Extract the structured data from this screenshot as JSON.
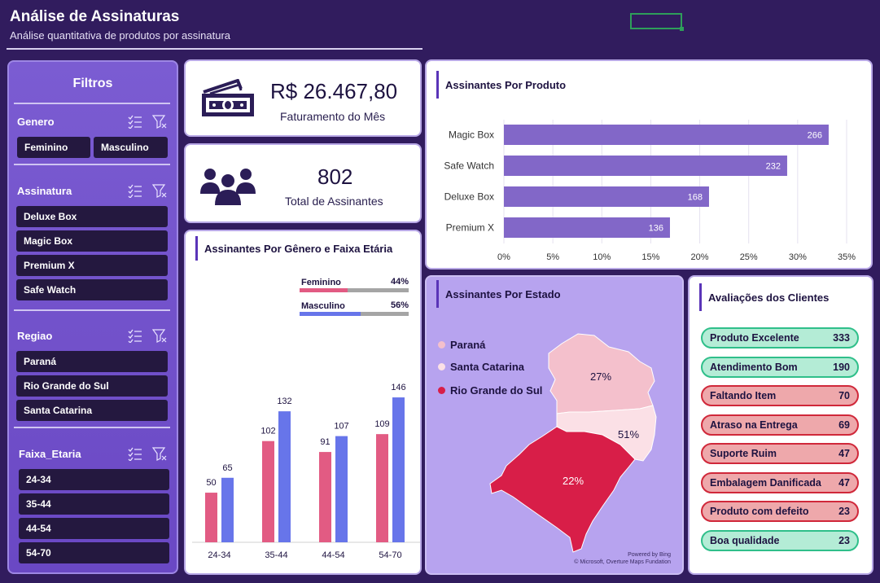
{
  "header": {
    "title": "Análise de Assinaturas",
    "subtitle": "Análise quantitativa de produtos por assinatura"
  },
  "filters": {
    "title": "Filtros",
    "genero": {
      "label": "Genero",
      "options": [
        "Feminino",
        "Masculino"
      ]
    },
    "assinatura": {
      "label": "Assinatura",
      "options": [
        "Deluxe Box",
        "Magic Box",
        "Premium X",
        "Safe Watch"
      ]
    },
    "regiao": {
      "label": "Regiao",
      "options": [
        "Paraná",
        "Rio Grande do Sul",
        "Santa Catarina"
      ]
    },
    "faixa": {
      "label": "Faixa_Etaria",
      "options": [
        "24-34",
        "35-44",
        "44-54",
        "54-70"
      ]
    }
  },
  "kpis": {
    "revenue_value": "R$ 26.467,80",
    "revenue_label": "Faturamento do Mês",
    "subs_value": "802",
    "subs_label": "Total de Assinantes"
  },
  "colors": {
    "background": "#311c5e",
    "bar_purple": "#8267c8",
    "female": "#e25b83",
    "male": "#6775ea",
    "parana": "#f4c0cc",
    "santa_catarina": "#fbe0e6",
    "rio_grande": "#d81e48",
    "good": "#b4ecd6",
    "bad": "#eea8ab"
  },
  "product_chart": {
    "title": "Assinantes Por Produto",
    "chart_data": {
      "type": "bar",
      "orientation": "horizontal",
      "categories": [
        "Magic Box",
        "Safe Watch",
        "Deluxe Box",
        "Premium X"
      ],
      "values": [
        266,
        232,
        168,
        136
      ],
      "total": 802,
      "xlim_percent": [
        0,
        35
      ],
      "xticks": [
        "0%",
        "5%",
        "10%",
        "15%",
        "20%",
        "25%",
        "30%",
        "35%"
      ]
    }
  },
  "gender_chart": {
    "title": "Assinantes Por Gênero e Faixa Etária",
    "legend": [
      {
        "name": "Feminino",
        "pct": "44%",
        "fraction": 0.44
      },
      {
        "name": "Masculino",
        "pct": "56%",
        "fraction": 0.56
      }
    ],
    "chart_data": {
      "type": "bar",
      "categories": [
        "24-34",
        "35-44",
        "44-54",
        "54-70"
      ],
      "series": [
        {
          "name": "Feminino",
          "values": [
            50,
            102,
            91,
            109
          ]
        },
        {
          "name": "Masculino",
          "values": [
            65,
            132,
            107,
            146
          ]
        }
      ],
      "ylim": [
        0,
        160
      ]
    }
  },
  "state_map": {
    "title": "Assinantes Por Estado",
    "legend": [
      "Paraná",
      "Santa Catarina",
      "Rio Grande do Sul"
    ],
    "labels": {
      "parana": "27%",
      "santa_catarina": "51%",
      "rio_grande": "22%"
    },
    "credit1": "Powered by Bing",
    "credit2": "© Microsoft, Overture Maps Fundation"
  },
  "ratings": {
    "title": "Avaliações dos Clientes",
    "items": [
      {
        "label": "Produto Excelente",
        "value": "333",
        "kind": "good"
      },
      {
        "label": "Atendimento Bom",
        "value": "190",
        "kind": "good"
      },
      {
        "label": "Faltando Item",
        "value": "70",
        "kind": "bad"
      },
      {
        "label": "Atraso na Entrega",
        "value": "69",
        "kind": "bad"
      },
      {
        "label": "Suporte Ruim",
        "value": "47",
        "kind": "bad"
      },
      {
        "label": "Embalagem Danificada",
        "value": "47",
        "kind": "bad"
      },
      {
        "label": "Produto com defeito",
        "value": "23",
        "kind": "bad"
      },
      {
        "label": "Boa qualidade",
        "value": "23",
        "kind": "good"
      }
    ]
  }
}
